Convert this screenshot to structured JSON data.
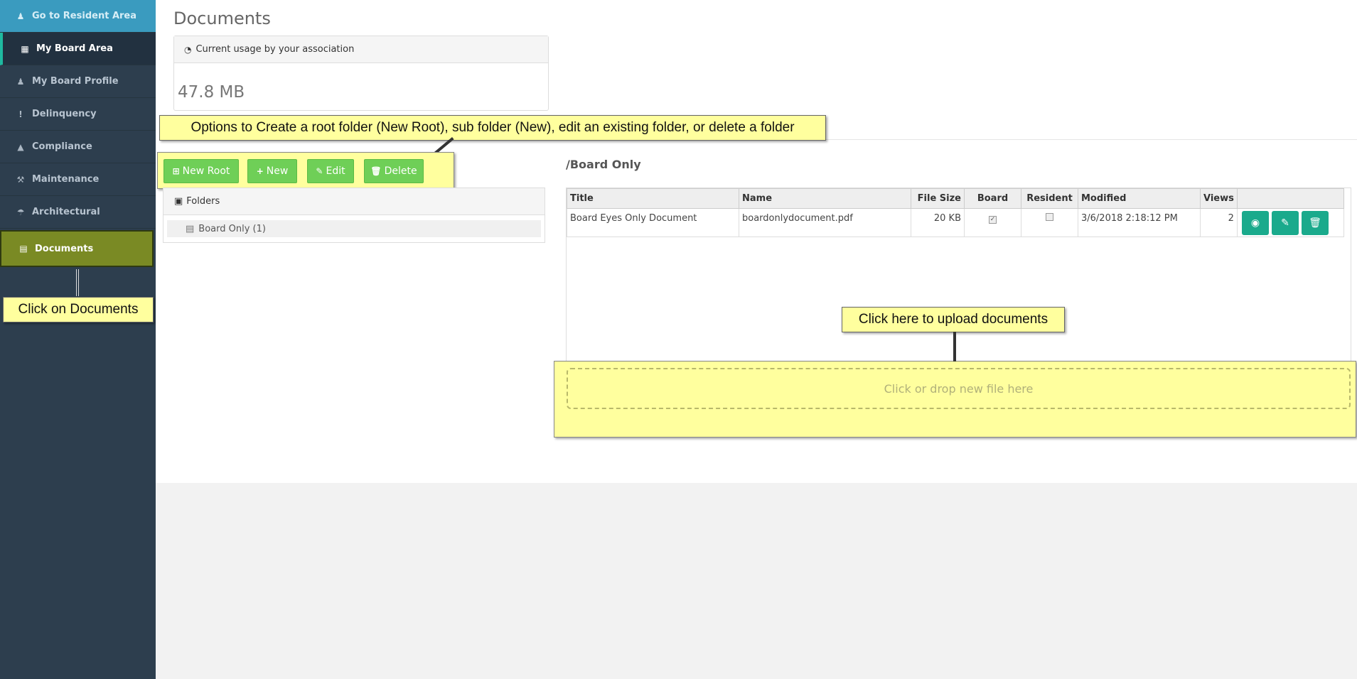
{
  "sidebar": {
    "items": [
      {
        "label": "Go to Resident Area",
        "icon": "user-icon"
      },
      {
        "label": "My Board Area",
        "icon": "grid-icon"
      },
      {
        "label": "My Board Profile",
        "icon": "user-icon"
      },
      {
        "label": "Delinquency",
        "icon": "exclamation-icon"
      },
      {
        "label": "Compliance",
        "icon": "warning-icon"
      },
      {
        "label": "Maintenance",
        "icon": "wrench-icon"
      },
      {
        "label": "Architectural",
        "icon": "umbrella-icon"
      },
      {
        "label": "Documents",
        "icon": "file-icon"
      }
    ]
  },
  "page": {
    "title": "Documents"
  },
  "usage": {
    "heading": "Current usage by your association",
    "value": "47.8 MB"
  },
  "toolbar": {
    "new_root": "New Root",
    "new": "New",
    "edit": "Edit",
    "delete": "Delete"
  },
  "folders": {
    "heading": "Folders",
    "items": [
      {
        "label": "Board Only (1)"
      }
    ]
  },
  "path": "/Board Only",
  "table": {
    "headers": [
      "Title",
      "Name",
      "File Size",
      "Board",
      "Resident",
      "Modified",
      "Views"
    ],
    "rows": [
      {
        "title": "Board Eyes Only Document",
        "name": "boardonlydocument.pdf",
        "size": "20 KB",
        "board": true,
        "resident": false,
        "modified": "3/6/2018 2:18:12 PM",
        "views": "2"
      }
    ]
  },
  "upload": {
    "placeholder": "Click or drop new file here"
  },
  "callouts": {
    "options": "Options to Create a root folder (New Root), sub folder (New), edit an existing folder, or delete a folder",
    "documents": "Click on Documents",
    "upload": "Click here to upload documents"
  },
  "colors": {
    "sidebar": "#2d3e4e",
    "accent_green": "#6fcf57",
    "action_teal": "#1aaa8c",
    "callout_yellow": "#ffff9e"
  }
}
